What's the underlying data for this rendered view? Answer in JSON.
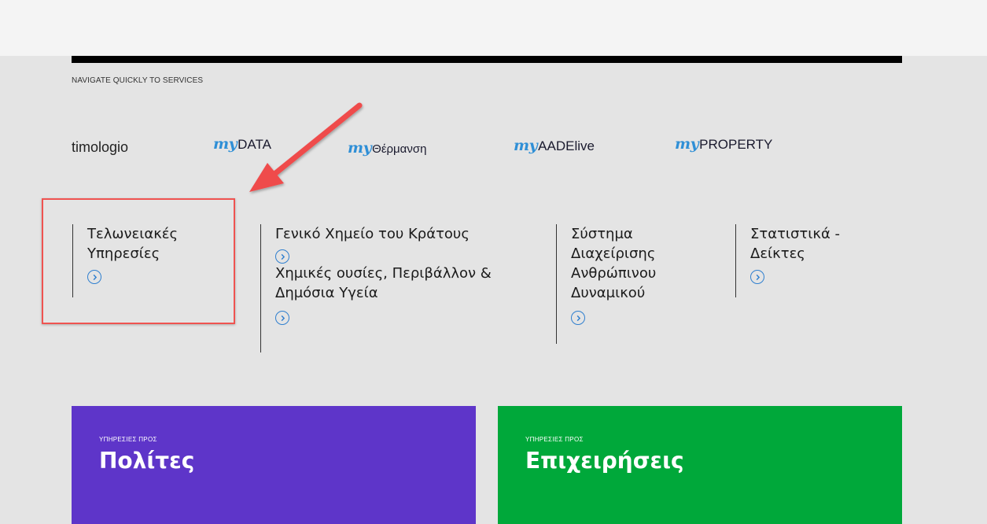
{
  "nav_title": "NAVIGATE QUICKLY TO SERVICES",
  "brands": [
    {
      "prefix": "",
      "name": "timologio"
    },
    {
      "prefix": "my",
      "name": "DATA"
    },
    {
      "prefix": "my",
      "name": "Θέρμανση"
    },
    {
      "prefix": "my",
      "name": "AADElive"
    },
    {
      "prefix": "my",
      "name": "PROPERTY"
    }
  ],
  "services": [
    {
      "title": "Τελωνειακές Υπηρεσίες"
    },
    {
      "title": "Γενικό Χημείο του Κράτους"
    },
    {
      "title": "Χημικές ουσίες, Περιβάλλον & Δημόσια Υγεία"
    },
    {
      "title": "Σύστημα Διαχείρισης Ανθρώπινου Δυναμικού"
    },
    {
      "title": "Στατιστικά - Δείκτες"
    }
  ],
  "tiles": [
    {
      "subtitle": "ΥΠΗΡΕΣΙΕΣ ΠΡΟΣ",
      "title": "Πολίτες",
      "color": "#5e35c9"
    },
    {
      "subtitle": "ΥΠΗΡΕΣΙΕΣ ΠΡΟΣ",
      "title": "Επιχειρήσεις",
      "color": "#00a83a"
    }
  ],
  "colors": {
    "highlight": "#ef5350",
    "accent": "#2f7fcf",
    "annotation_arrow": "#ef4b4b"
  },
  "icons": {
    "service_link": "chevron-right-circle-icon"
  }
}
